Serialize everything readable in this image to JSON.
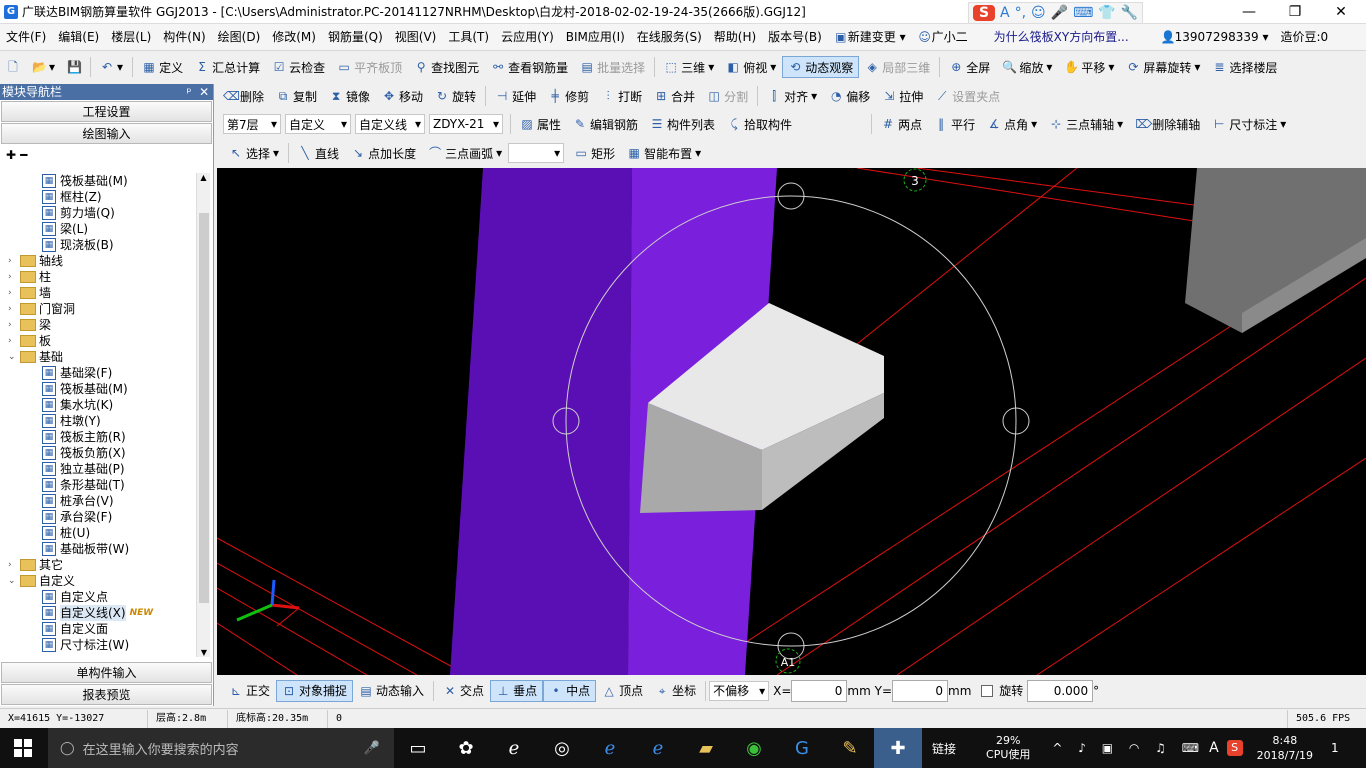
{
  "window": {
    "title": "广联达BIM钢筋算量软件 GGJ2013 - [C:\\Users\\Administrator.PC-20141127NRHM\\Desktop\\白龙村-2018-02-02-19-24-35(2666版).GGJ12]",
    "minimize": "—",
    "restore": "❐",
    "close": "✕"
  },
  "ime": {
    "logo": "S",
    "items": [
      "A",
      "°,",
      "☺",
      "🎤",
      "⌨",
      "👕",
      "🔧"
    ]
  },
  "menu": [
    "文件(F)",
    "编辑(E)",
    "楼层(L)",
    "构件(N)",
    "绘图(D)",
    "修改(M)",
    "钢筋量(Q)",
    "视图(V)",
    "工具(T)",
    "云应用(Y)",
    "BIM应用(I)",
    "在线服务(S)",
    "帮助(H)",
    "版本号(B)",
    "新建变更",
    "广小二"
  ],
  "menu_right": {
    "question": "为什么筏板XY方向布置...",
    "phone": "13907298339",
    "beans": "造价豆:0"
  },
  "toolbar1": {
    "define": "定义",
    "sum": "汇总计算",
    "cloud_check": "云检查",
    "flat_top": "平齐板顶",
    "find": "查找图元",
    "view_rebar": "查看钢筋量",
    "batch": "批量选择",
    "three_d": "三维",
    "top_view": "俯视",
    "dynamic": "动态观察",
    "local_3d": "局部三维",
    "fullscreen": "全屏",
    "zoom": "缩放",
    "pan": "平移",
    "rotate_screen": "屏幕旋转",
    "select_floor": "选择楼层"
  },
  "toolbar2": {
    "delete": "删除",
    "copy": "复制",
    "mirror": "镜像",
    "move": "移动",
    "rotate": "旋转",
    "extend": "延伸",
    "trim": "修剪",
    "break": "打断",
    "merge": "合并",
    "split": "分割",
    "align": "对齐",
    "offset": "偏移",
    "stretch": "拉伸",
    "set_grip": "设置夹点"
  },
  "toolbar3": {
    "floor": "第7层",
    "category": "自定义",
    "type": "自定义线",
    "component": "ZDYX-21",
    "props": "属性",
    "edit_rebar": "编辑钢筋",
    "comp_list": "构件列表",
    "pick": "拾取构件",
    "two_point": "两点",
    "parallel": "平行",
    "point_angle": "点角",
    "three_point_aux": "三点辅轴",
    "del_aux": "删除辅轴",
    "dim": "尺寸标注"
  },
  "toolbar4": {
    "select": "选择",
    "line": "直线",
    "point_len": "点加长度",
    "arc": "三点画弧",
    "rect": "矩形",
    "smart": "智能布置"
  },
  "nav": {
    "title": "模块导航栏",
    "pin": "ᵖ",
    "close": "✕",
    "project": "工程设置",
    "draw": "绘图输入",
    "single": "单构件输入",
    "report": "报表预览"
  },
  "tree": [
    {
      "level": 2,
      "label": "筏板基础(M)",
      "kind": "leaf"
    },
    {
      "level": 2,
      "label": "框柱(Z)",
      "kind": "leaf"
    },
    {
      "level": 2,
      "label": "剪力墙(Q)",
      "kind": "leaf"
    },
    {
      "level": 2,
      "label": "梁(L)",
      "kind": "leaf"
    },
    {
      "level": 2,
      "label": "现浇板(B)",
      "kind": "leaf"
    },
    {
      "level": 1,
      "label": "轴线",
      "kind": "folder",
      "exp": "›"
    },
    {
      "level": 1,
      "label": "柱",
      "kind": "folder",
      "exp": "›"
    },
    {
      "level": 1,
      "label": "墙",
      "kind": "folder",
      "exp": "›"
    },
    {
      "level": 1,
      "label": "门窗洞",
      "kind": "folder",
      "exp": "›"
    },
    {
      "level": 1,
      "label": "梁",
      "kind": "folder",
      "exp": "›"
    },
    {
      "level": 1,
      "label": "板",
      "kind": "folder",
      "exp": "›"
    },
    {
      "level": 1,
      "label": "基础",
      "kind": "folder",
      "exp": "⌄"
    },
    {
      "level": 2,
      "label": "基础梁(F)",
      "kind": "leaf"
    },
    {
      "level": 2,
      "label": "筏板基础(M)",
      "kind": "leaf"
    },
    {
      "level": 2,
      "label": "集水坑(K)",
      "kind": "leaf"
    },
    {
      "level": 2,
      "label": "柱墩(Y)",
      "kind": "leaf"
    },
    {
      "level": 2,
      "label": "筏板主筋(R)",
      "kind": "leaf"
    },
    {
      "level": 2,
      "label": "筏板负筋(X)",
      "kind": "leaf"
    },
    {
      "level": 2,
      "label": "独立基础(P)",
      "kind": "leaf"
    },
    {
      "level": 2,
      "label": "条形基础(T)",
      "kind": "leaf"
    },
    {
      "level": 2,
      "label": "桩承台(V)",
      "kind": "leaf"
    },
    {
      "level": 2,
      "label": "承台梁(F)",
      "kind": "leaf"
    },
    {
      "level": 2,
      "label": "桩(U)",
      "kind": "leaf"
    },
    {
      "level": 2,
      "label": "基础板带(W)",
      "kind": "leaf"
    },
    {
      "level": 1,
      "label": "其它",
      "kind": "folder",
      "exp": "›"
    },
    {
      "level": 1,
      "label": "自定义",
      "kind": "folder",
      "exp": "⌄"
    },
    {
      "level": 2,
      "label": "自定义点",
      "kind": "leaf"
    },
    {
      "level": 2,
      "label": "自定义线(X)",
      "kind": "leaf",
      "badge": "NEW",
      "selected": true
    },
    {
      "level": 2,
      "label": "自定义面",
      "kind": "leaf"
    },
    {
      "level": 2,
      "label": "尺寸标注(W)",
      "kind": "leaf"
    }
  ],
  "canvas": {
    "axis_top": "3",
    "axis_bottom": "A1"
  },
  "snapbar": {
    "ortho": "正交",
    "snap": "对象捕捉",
    "dyn_input": "动态输入",
    "intersect": "交点",
    "perp": "垂点",
    "mid": "中点",
    "vertex": "顶点",
    "coord": "坐标",
    "offset_mode": "不偏移",
    "x_label": "X=",
    "x_val": "0",
    "y_label": "Y=",
    "y_val": "0",
    "unit": "mm",
    "rotate": "旋转",
    "rotate_val": "0.000",
    "deg": "°"
  },
  "status": {
    "coords": "X=41615 Y=-13027",
    "floor_h": "层高:2.8m",
    "base_h": "底标高:20.35m",
    "num": "0",
    "fps": "505.6 FPS"
  },
  "taskbar": {
    "search": "在这里输入你要搜索的内容",
    "link": "链接",
    "cpu": "29%",
    "cpu_label": "CPU使用",
    "time": "8:48",
    "date": "2018/7/19",
    "lang": "A",
    "notif": "1"
  }
}
